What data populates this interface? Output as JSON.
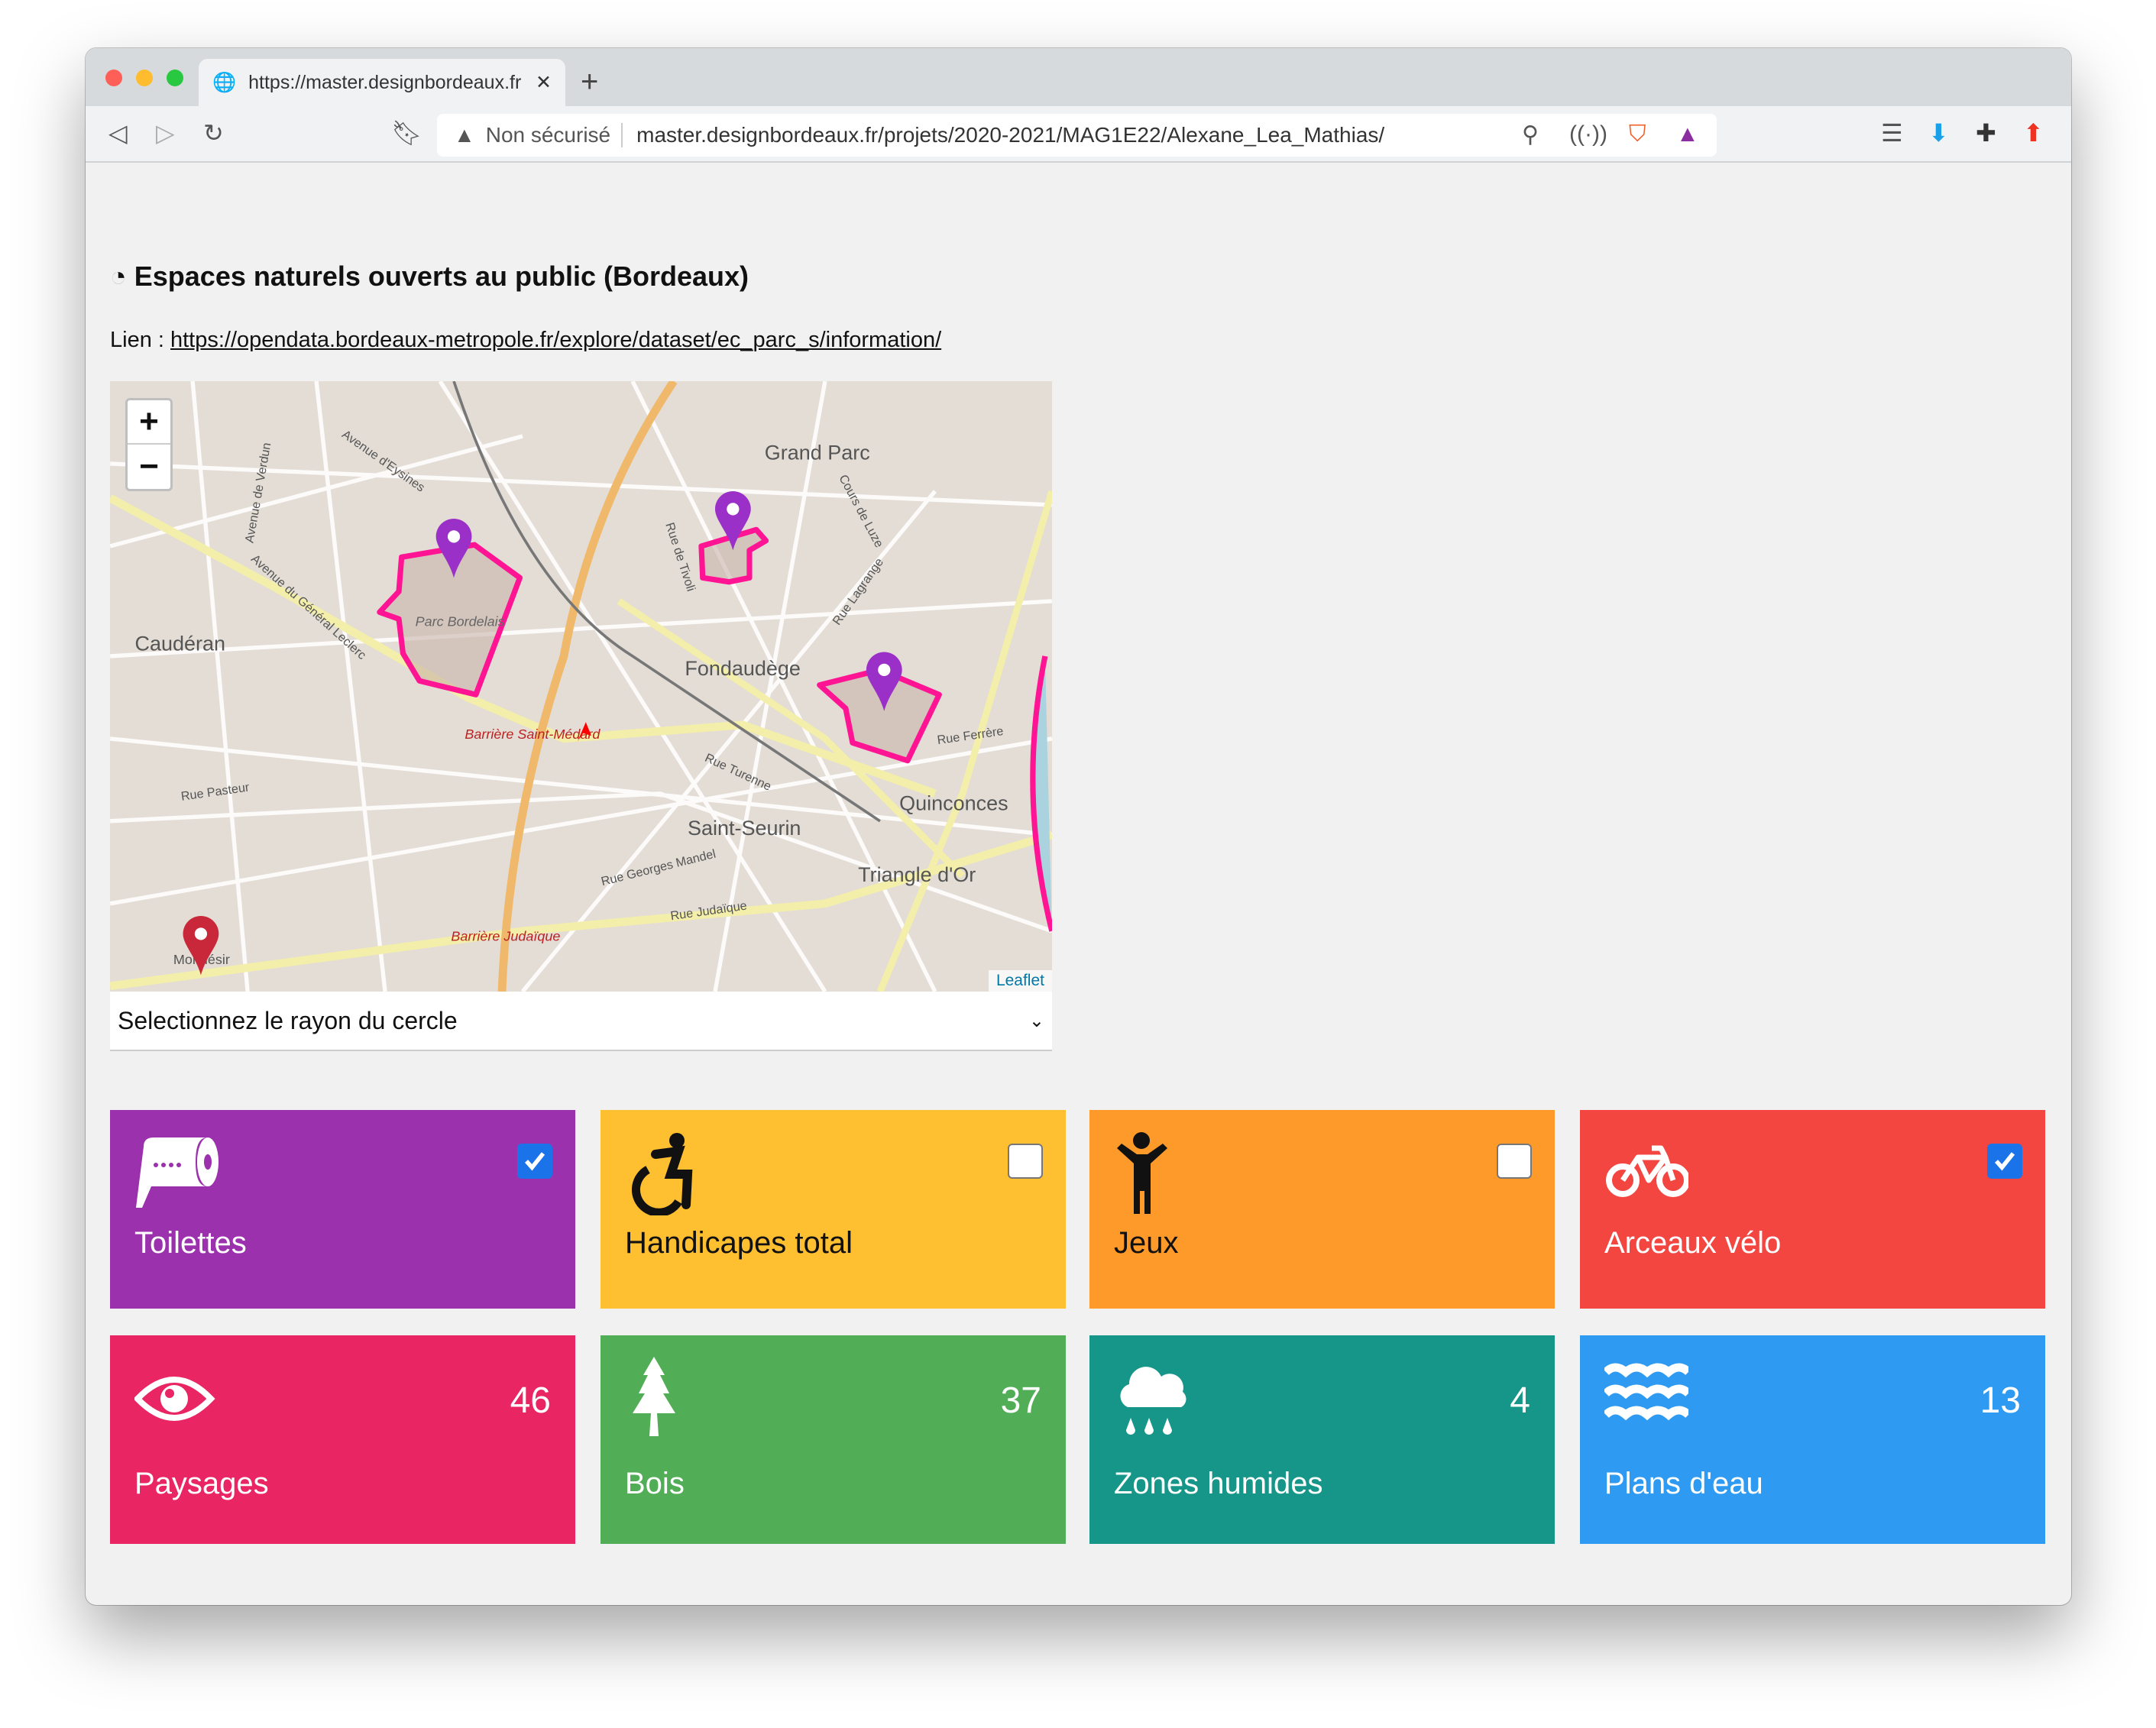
{
  "browser": {
    "tab_title": "https://master.designbordeaux.fr",
    "security_label": "Non sécurisé",
    "url": "master.designbordeaux.fr/projets/2020-2021/MAG1E22/Alexane_Lea_Mathias/"
  },
  "page": {
    "title": "Espaces naturels ouverts au public (Bordeaux)",
    "link_prefix": "Lien : ",
    "link_text": "https://opendata.bordeaux-metropole.fr/explore/dataset/ec_parc_s/information/"
  },
  "map": {
    "zoom_in": "+",
    "zoom_out": "−",
    "attribution": "Leaflet",
    "labels": [
      "Grand Parc",
      "Caudéran",
      "Fondaudège",
      "Saint-Seurin",
      "Quinconces",
      "Triangle d'Or",
      "Barrière Saint-Médard",
      "Barrière Judaïque",
      "Parc Bordelais",
      "Rue Judaïque",
      "Rue Pasteur",
      "Rue Georges Mandel",
      "Rue Turenne",
      "Rue Ferrère",
      "Avenue d'Eysines",
      "Avenue du Général Leclerc",
      "Avenue de Verdun",
      "Rue de Tivoli",
      "Cours de Luze",
      "Rue Lagrange",
      "Mondésir"
    ]
  },
  "select": {
    "label": "Selectionnez le rayon du cercle"
  },
  "colors": {
    "purple": "#9c31ae",
    "yellow": "#febf31",
    "orange": "#fe9a29",
    "red": "#f44641",
    "pink": "#e92564",
    "green": "#51ae56",
    "teal": "#169689",
    "blue": "#2f9af1"
  },
  "filters": [
    {
      "label": "Toilettes",
      "icon": "toilet-paper-icon",
      "checked": true
    },
    {
      "label": "Handicapes total",
      "icon": "wheelchair-icon",
      "checked": false
    },
    {
      "label": "Jeux",
      "icon": "child-icon",
      "checked": false
    },
    {
      "label": "Arceaux vélo",
      "icon": "bicycle-icon",
      "checked": true
    }
  ],
  "stats": [
    {
      "label": "Paysages",
      "value": "46",
      "icon": "eye-icon"
    },
    {
      "label": "Bois",
      "value": "37",
      "icon": "tree-icon"
    },
    {
      "label": "Zones humides",
      "value": "4",
      "icon": "cloud-rain-icon"
    },
    {
      "label": "Plans d'eau",
      "value": "13",
      "icon": "water-icon"
    }
  ]
}
